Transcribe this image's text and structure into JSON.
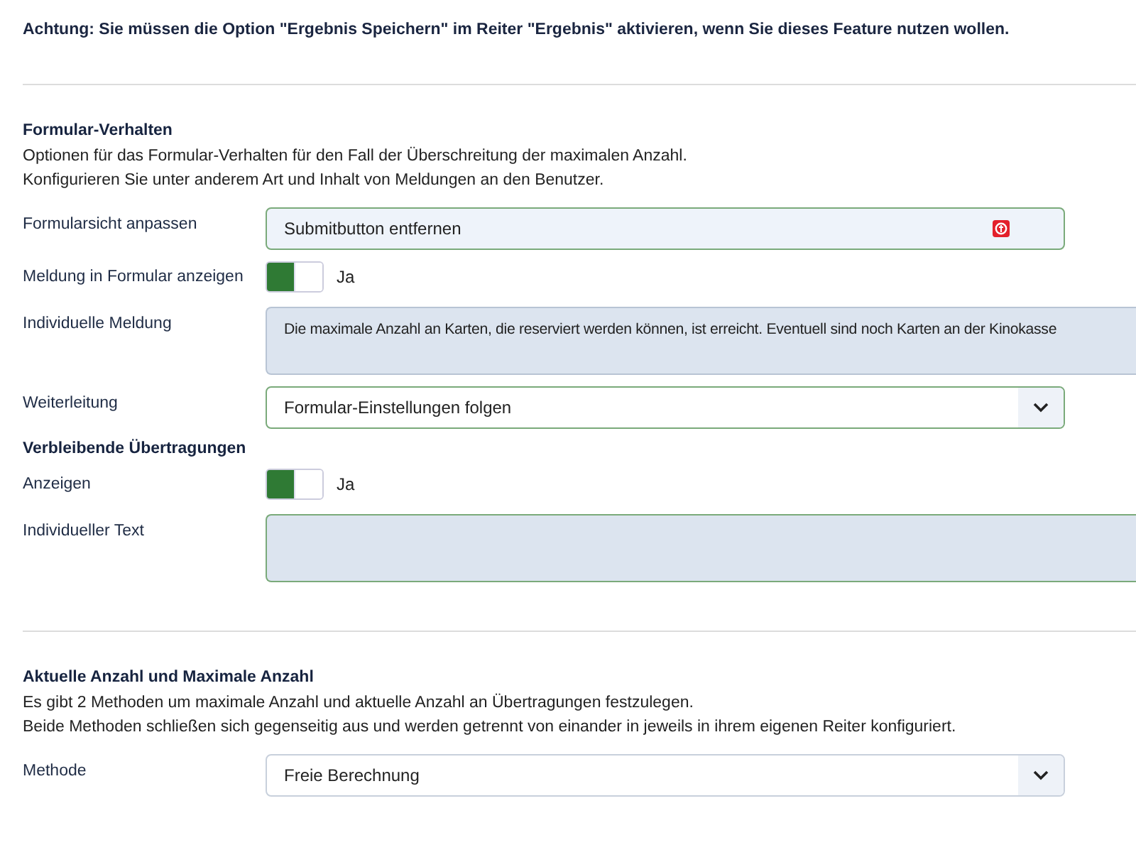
{
  "notice": "Achtung: Sie müssen die Option \"Ergebnis Speichern\" im Reiter \"Ergebnis\" aktivieren, wenn Sie dieses Feature nutzen wollen.",
  "sections": [
    {
      "title": "Formular-Verhalten",
      "description": [
        "Optionen für das Formular-Verhalten für den Fall der Überschreitung der maximalen Anzahl.",
        "Konfigurieren Sie unter anderem Art und Inhalt von Meldungen an den Benutzer."
      ],
      "rows": [
        {
          "kind": "field",
          "label": "Formularsicht anpassen",
          "value": "Submitbutton entfernen"
        },
        {
          "kind": "toggle",
          "label": "Meldung in Formular anzeigen",
          "on": true,
          "state_text": "Ja"
        },
        {
          "kind": "textarea",
          "label": "Individuelle Meldung",
          "value": "Die maximale Anzahl an Karten, die reserviert werden können, ist erreicht. Eventuell sind noch Karten an der Kinokasse"
        },
        {
          "kind": "select",
          "label": "Weiterleitung",
          "value": "Formular-Einstellungen folgen"
        },
        {
          "kind": "heading",
          "label": "Verbleibende Übertragungen"
        },
        {
          "kind": "toggle",
          "label": "Anzeigen",
          "on": true,
          "state_text": "Ja"
        },
        {
          "kind": "textarea",
          "label": "Individueller Text"
        }
      ]
    },
    {
      "title": "Aktuelle Anzahl und Maximale Anzahl",
      "description": [
        "Es gibt 2 Methoden um maximale Anzahl und aktuelle Anzahl an Übertragungen festzulegen.",
        "Beide Methoden schließen sich gegenseitig aus und werden getrennt von einander in jeweils in ihrem eigenen Reiter konfiguriert."
      ],
      "rows": [
        {
          "kind": "select",
          "label": "Methode",
          "value": "Freie Berechnung"
        }
      ]
    }
  ]
}
